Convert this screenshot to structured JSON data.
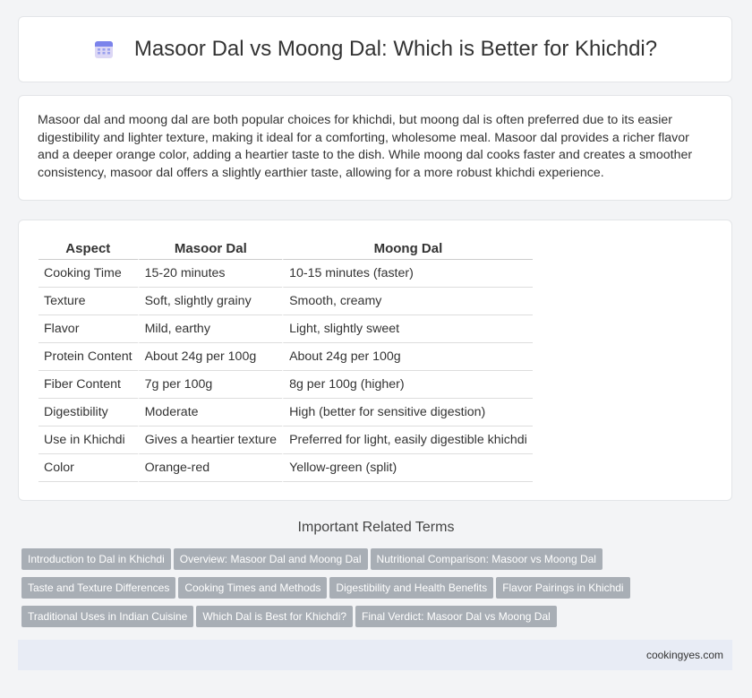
{
  "header": {
    "icon": "calendar-icon",
    "title": "Masoor Dal vs Moong Dal: Which is Better for Khichdi?"
  },
  "intro": "Masoor dal and moong dal are both popular choices for khichdi, but moong dal is often preferred due to its easier digestibility and lighter texture, making it ideal for a comforting, wholesome meal. Masoor dal provides a richer flavor and a deeper orange color, adding a heartier taste to the dish. While moong dal cooks faster and creates a smoother consistency, masoor dal offers a slightly earthier taste, allowing for a more robust khichdi experience.",
  "table": {
    "headers": [
      "Aspect",
      "Masoor Dal",
      "Moong Dal"
    ],
    "rows": [
      [
        "Cooking Time",
        "15-20 minutes",
        "10-15 minutes (faster)"
      ],
      [
        "Texture",
        "Soft, slightly grainy",
        "Smooth, creamy"
      ],
      [
        "Flavor",
        "Mild, earthy",
        "Light, slightly sweet"
      ],
      [
        "Protein Content",
        "About 24g per 100g",
        "About 24g per 100g"
      ],
      [
        "Fiber Content",
        "7g per 100g",
        "8g per 100g (higher)"
      ],
      [
        "Digestibility",
        "Moderate",
        "High (better for sensitive digestion)"
      ],
      [
        "Use in Khichdi",
        "Gives a heartier texture",
        "Preferred for light, easily digestible khichdi"
      ],
      [
        "Color",
        "Orange-red",
        "Yellow-green (split)"
      ]
    ]
  },
  "related": {
    "title": "Important Related Terms",
    "tags": [
      "Introduction to Dal in Khichdi",
      "Overview: Masoor Dal and Moong Dal",
      "Nutritional Comparison: Masoor vs Moong Dal",
      "Taste and Texture Differences",
      "Cooking Times and Methods",
      "Digestibility and Health Benefits",
      "Flavor Pairings in Khichdi",
      "Traditional Uses in Indian Cuisine",
      "Which Dal is Best for Khichdi?",
      "Final Verdict: Masoor Dal vs Moong Dal"
    ]
  },
  "footer": {
    "site": "cookingyes.com"
  }
}
